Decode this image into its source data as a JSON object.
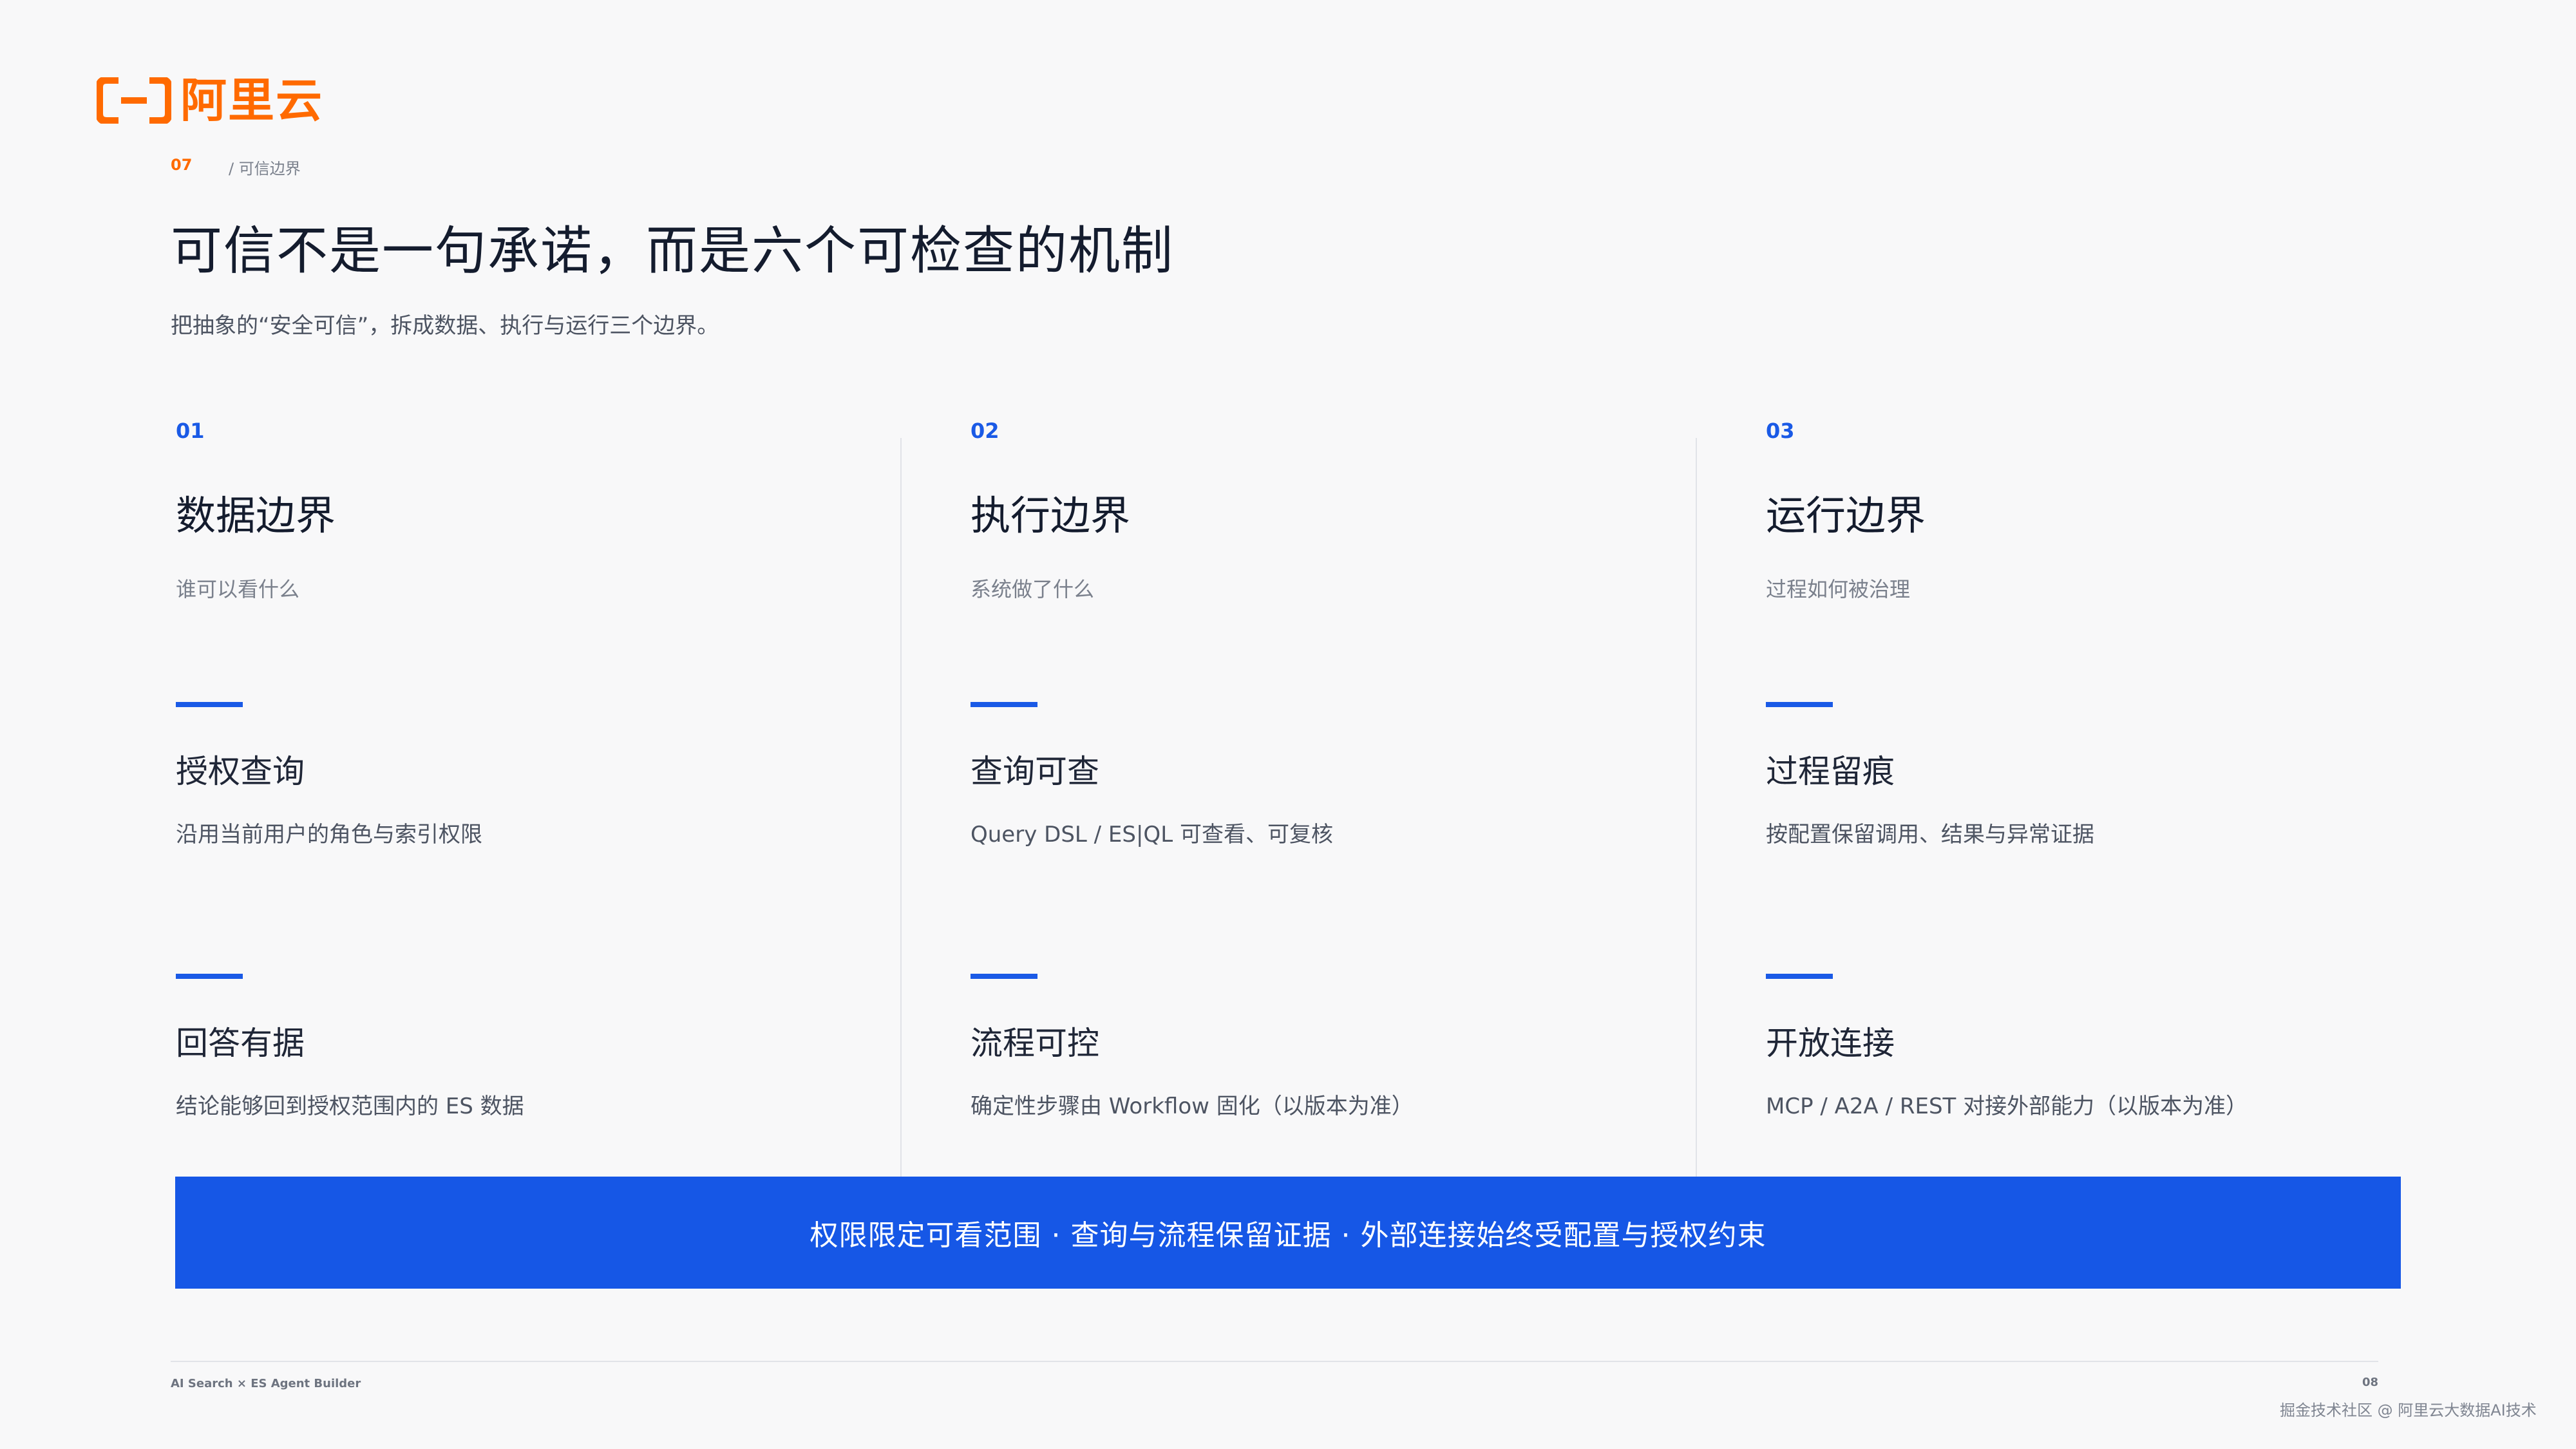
{
  "brand": {
    "name": "阿里云",
    "color": "#ff6a00"
  },
  "section": {
    "number": "07",
    "name": "/  可信边界"
  },
  "title": "可信不是一句承诺，而是六个可检查的机制",
  "subtitle": "把抽象的“安全可信”，拆成数据、执行与运行三个边界。",
  "columns": [
    {
      "num": "01",
      "title": "数据边界",
      "sub": "谁可以看什么",
      "items": [
        {
          "title": "授权查询",
          "desc": "沿用当前用户的角色与索引权限"
        },
        {
          "title": "回答有据",
          "desc": "结论能够回到授权范围内的 ES 数据"
        }
      ]
    },
    {
      "num": "02",
      "title": "执行边界",
      "sub": "系统做了什么",
      "items": [
        {
          "title": "查询可查",
          "desc": "Query DSL / ES|QL 可查看、可复核"
        },
        {
          "title": "流程可控",
          "desc": "确定性步骤由 Workflow 固化（以版本为准）"
        }
      ]
    },
    {
      "num": "03",
      "title": "运行边界",
      "sub": "过程如何被治理",
      "items": [
        {
          "title": "过程留痕",
          "desc": "按配置保留调用、结果与异常证据"
        },
        {
          "title": "开放连接",
          "desc": "MCP / A2A / REST 对接外部能力（以版本为准）"
        }
      ]
    }
  ],
  "banner": "权限限定可看范围  ·  查询与流程保留证据  ·  外部连接始终受配置与授权约束",
  "footer": {
    "left": "AI Search × ES Agent Builder",
    "page": "08",
    "watermark": "掘金技术社区 @ 阿里云大数据AI技术"
  },
  "colors": {
    "accent_blue": "#1657e6",
    "accent_orange": "#ff6a00",
    "background": "#f8f8f9"
  }
}
